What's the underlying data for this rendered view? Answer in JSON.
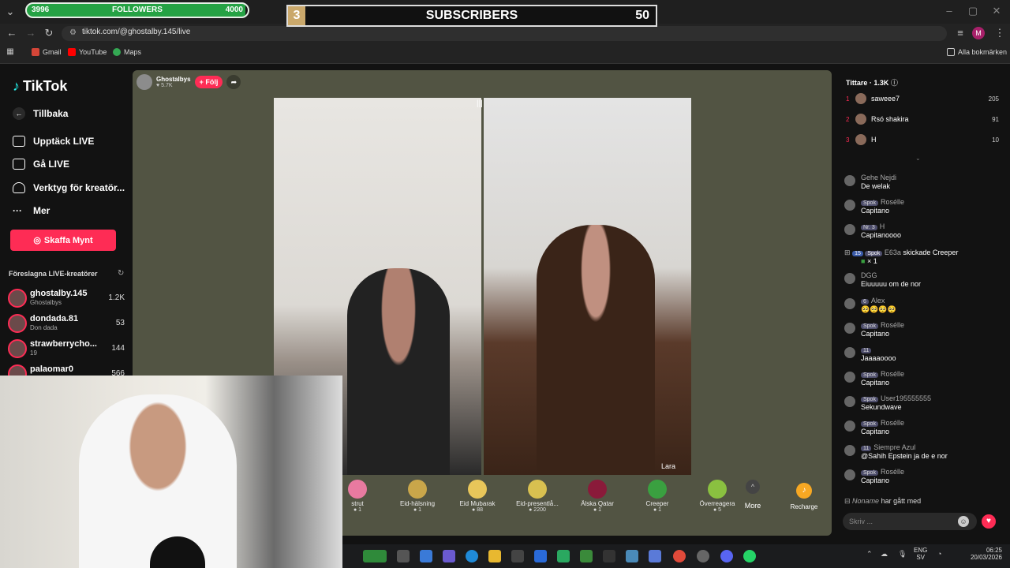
{
  "browser": {
    "url": "tiktok.com/@ghostalby.145/live",
    "bookmarks": [
      "Gmail",
      "YouTube",
      "Maps"
    ],
    "all_bookmarks": "Alla bokmärken",
    "profile_initial": "M"
  },
  "overlays": {
    "followers_start": "3996",
    "followers_label": "FOLLOWERS",
    "followers_goal": "4000",
    "followers_progress": 0.99,
    "subs_rank": "3",
    "subs_label": "SUBSCRIBERS",
    "subs_count": "50"
  },
  "sidebar": {
    "logo": "TikTok",
    "back": "Tillbaka",
    "items": [
      "Upptäck LIVE",
      "Gå LIVE",
      "Verktyg för kreatör...",
      "Mer"
    ],
    "coin_button": "Skaffa Mynt",
    "suggested_title": "Föreslagna LIVE-kreatörer",
    "creators": [
      {
        "name": "ghostalby.145",
        "sub": "Ghostalbys",
        "count": "1.2K"
      },
      {
        "name": "dondada.81",
        "sub": "Don dada",
        "count": "53"
      },
      {
        "name": "strawberrycho...",
        "sub": "19",
        "count": "144"
      },
      {
        "name": "palaomar0",
        "sub": "",
        "count": "566"
      }
    ]
  },
  "stream": {
    "host_name": "Ghostalbys",
    "host_likes": "5.7K",
    "follow_label": "+ Följ",
    "guest_label": "Lara"
  },
  "gifts": [
    {
      "label": "strut",
      "price": "1",
      "color": "#e87aa0"
    },
    {
      "label": "Eid-hälsning",
      "price": "1",
      "color": "#c9a64a"
    },
    {
      "label": "Eid Mubarak",
      "price": "88",
      "color": "#e8c65a"
    },
    {
      "label": "Eid-presentlå...",
      "price": "2200",
      "color": "#d8c050"
    },
    {
      "label": "Älska Qatar",
      "price": "1",
      "color": "#8a1a3a"
    },
    {
      "label": "Creeper",
      "price": "1",
      "color": "#3aa040"
    },
    {
      "label": "Överreagera",
      "price": "5",
      "color": "#8ac040"
    }
  ],
  "gift_more": "More",
  "recharge": "Recharge",
  "chat": {
    "viewers_title": "Tittare",
    "viewers_count": "1.3K",
    "top_viewers": [
      {
        "rank": "1",
        "name": "saweee7",
        "score": "205"
      },
      {
        "rank": "2",
        "name": "Rsó shakira",
        "score": "91"
      },
      {
        "rank": "3",
        "name": "H",
        "score": "10"
      }
    ],
    "messages": [
      {
        "name": "Gehe Nejdi",
        "badge": "",
        "text": "De welak"
      },
      {
        "name": "Rosélle",
        "badge": "Spok",
        "text": "Capitano"
      },
      {
        "name": "H",
        "badge": "Nr. 3",
        "text": "Capitanoooo"
      },
      {
        "name": "DGG",
        "badge": "",
        "text": "Eiuuuuu om de nor"
      },
      {
        "name": "Alex",
        "badge": "6",
        "text": "🥺🥺🥺🥺"
      },
      {
        "name": "Rosélle",
        "badge": "Spok",
        "text": "Capitano"
      },
      {
        "name": "",
        "badge": "11",
        "text": "Jaaaaoooo"
      },
      {
        "name": "Rosélle",
        "badge": "Spok",
        "text": "Capitano"
      },
      {
        "name": "User195555555",
        "badge": "Spok",
        "text": "Sekundwave"
      },
      {
        "name": "Rosélle",
        "badge": "Spok",
        "text": "Capitano"
      },
      {
        "name": "Siempre Azul",
        "badge": "11",
        "text": "@Sahih Epstein ja de e nor"
      },
      {
        "name": "Rosélle",
        "badge": "Spok",
        "text": "Capitano"
      }
    ],
    "gift_user": "E63a",
    "gift_text": "skickade Creeper",
    "gift_count": "× 1",
    "gift_badge1": "15",
    "gift_badge2": "Spok",
    "join_user": "Noname",
    "join_text": "har gått med",
    "input_placeholder": "Skriv ..."
  },
  "taskbar": {
    "lang": "ENG",
    "lang_sub": "SV",
    "time": "06:25",
    "date": "20/03/2026"
  }
}
